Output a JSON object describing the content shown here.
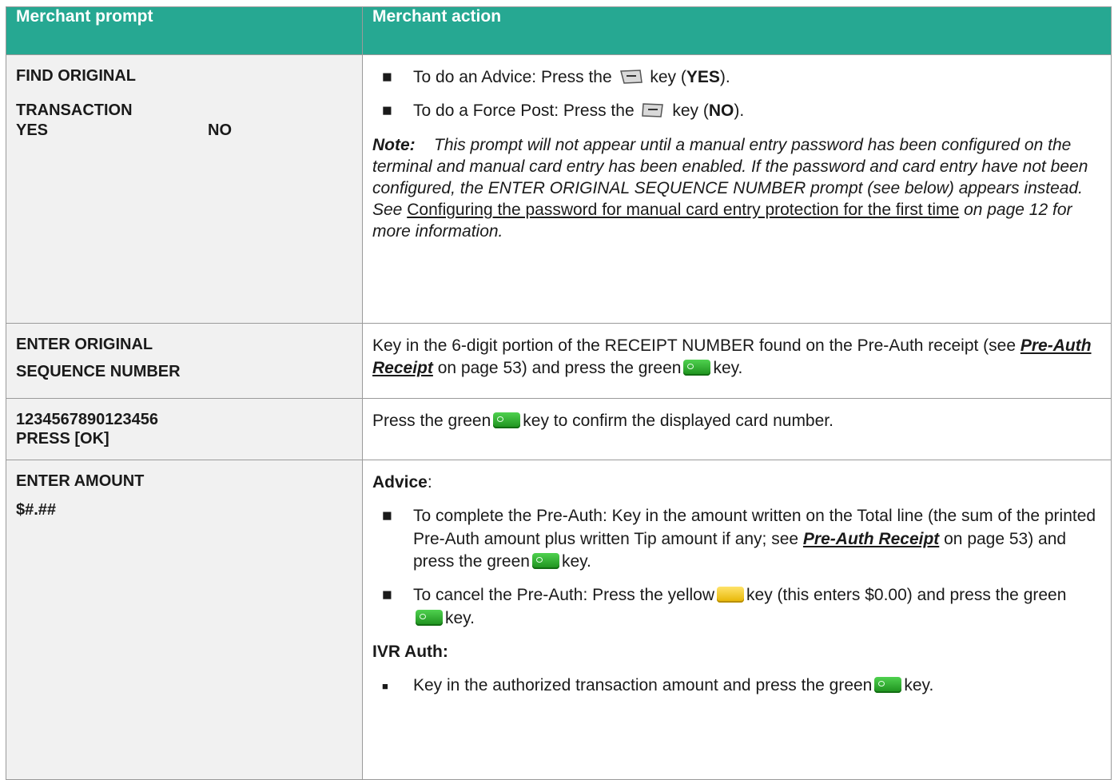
{
  "headers": {
    "prompt": "Merchant prompt",
    "action": "Merchant action"
  },
  "rows": [
    {
      "prompt_lines": [
        "FIND ORIGINAL",
        "TRANSACTION"
      ],
      "prompt_yes": "YES",
      "prompt_no": "NO",
      "bullet1": {
        "pre": "To do an Advice: Press the",
        "post": "key (",
        "bold": "YES",
        "end": ")."
      },
      "bullet2": {
        "pre": "To do a Force Post: Press the",
        "post": "key (",
        "bold": "NO",
        "end": ")."
      },
      "note": {
        "label": "Note:",
        "text": "This prompt will not appear until a manual entry password has been configured on the terminal and manual card entry has been enabled. If the password and card entry have not been configured, the ENTER ORIGINAL SEQUENCE NUMBER prompt (see below) appears instead. See",
        "link": "Configuring the password for manual card entry protection for the first time",
        "after": "on page 12 for more information."
      }
    },
    {
      "prompt_lines": [
        "ENTER ORIGINAL",
        "SEQUENCE NUMBER"
      ],
      "action": {
        "pre": "Key in the 6-digit portion of the RECEIPT NUMBER found on the Pre-Auth receipt (see",
        "link": "Pre-Auth Receipt",
        "mid": "on page 53) and press the green",
        "end": "key."
      }
    },
    {
      "prompt_lines": [
        "1234567890123456",
        "PRESS [OK]"
      ],
      "action": {
        "pre": "Press the green",
        "end": "key to confirm the displayed card number."
      }
    },
    {
      "prompt_lines": [
        "ENTER AMOUNT",
        "$#.##"
      ],
      "advice_label": "Advice",
      "advice_colon": ":",
      "bullet1": {
        "pre": "To complete the Pre-Auth: Key in the amount written on the Total line (the sum of the printed Pre-Auth amount plus written Tip amount if any; see",
        "link": "Pre-Auth Receipt",
        "mid": "on page 53) and press the green",
        "end": "key."
      },
      "bullet2": {
        "pre": "To cancel the Pre-Auth: Press the yellow",
        "mid": "key (this enters $0.00) and press the green",
        "end": "key."
      },
      "ivr_label": "IVR Auth:",
      "bullet3": {
        "pre": "Key in the authorized transaction amount and press the green",
        "end": "key."
      }
    }
  ],
  "icons": [
    "softkey-yes-icon",
    "softkey-no-icon",
    "green-ok-key-icon",
    "yellow-clear-key-icon"
  ],
  "colors": {
    "header_bg": "#26a892",
    "prompt_bg": "#f1f1f1",
    "border": "#9a9a9a"
  }
}
